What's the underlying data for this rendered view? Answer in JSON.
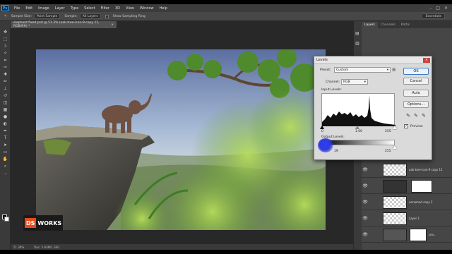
{
  "menubar": {
    "items": [
      "File",
      "Edit",
      "Image",
      "Layer",
      "Type",
      "Select",
      "Filter",
      "3D",
      "View",
      "Window",
      "Help"
    ]
  },
  "optbar": {
    "sample_size_label": "Sample Size:",
    "sample_size_value": "Point Sample",
    "sample_label": "Sample:",
    "sample_value": "All Layers",
    "show_ring_label": "Show Sampling Ring",
    "workspace": "Essentials"
  },
  "document": {
    "tab_title": "elephant fixed.psd @ 51.3% (oak-tree-icon-9 copy 11, RGB/8#) *"
  },
  "watermark": {
    "left": "DS",
    "right": "WORKS"
  },
  "status": {
    "zoom": "51.39%",
    "doc": "Doc: 5.93M/1.30G"
  },
  "layers_panel": {
    "tabs": [
      "Layers",
      "Channels",
      "Paths"
    ],
    "layers": [
      {
        "name": "oak-tree-icon-9 copy 11"
      },
      {
        "name": ""
      },
      {
        "name": "unnamed copy 2"
      },
      {
        "name": "Layer 1"
      },
      {
        "name": "Lev..."
      }
    ]
  },
  "levels_dialog": {
    "title": "Levels",
    "preset_label": "Preset:",
    "preset_value": "Custom",
    "channel_label": "Channel:",
    "channel_value": "RGB",
    "input_label": "Input Levels:",
    "input_black": "0",
    "input_gamma": "1.00",
    "input_white": "255",
    "output_label": "Output Levels:",
    "output_black": "19",
    "output_white": "255",
    "buttons": {
      "ok": "OK",
      "cancel": "Cancel",
      "auto": "Auto",
      "options": "Options..."
    },
    "preview_label": "Preview",
    "preview_checked": true
  }
}
